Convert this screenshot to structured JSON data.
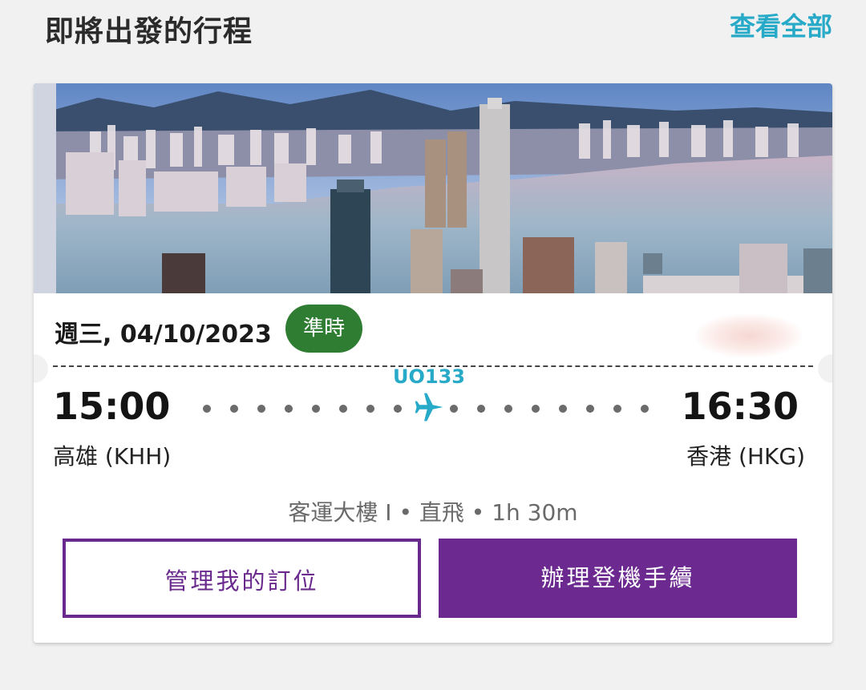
{
  "section": {
    "title": "即將出發的行程",
    "view_all": "查看全部"
  },
  "trip": {
    "date": "週三, 04/10/2023",
    "status": "準時",
    "flight_number": "UO133",
    "departure": {
      "time": "15:00",
      "airport": "高雄 (KHH)"
    },
    "arrival": {
      "time": "16:30",
      "airport": "香港 (HKG)"
    },
    "details": "客運大樓 I • 直飛 • 1h 30m",
    "buttons": {
      "manage": "管理我的訂位",
      "check_in": "辦理登機手續"
    }
  },
  "colors": {
    "accent": "#27a9c8",
    "status_on_time": "#2e7d32",
    "brand_purple": "#6c2a91"
  }
}
